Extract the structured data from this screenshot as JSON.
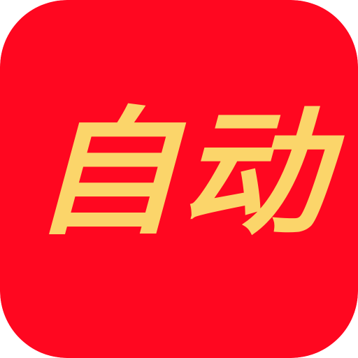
{
  "app_icon": {
    "label": "自动",
    "background_color": "#FF0720",
    "text_color": "#FBD56A"
  }
}
